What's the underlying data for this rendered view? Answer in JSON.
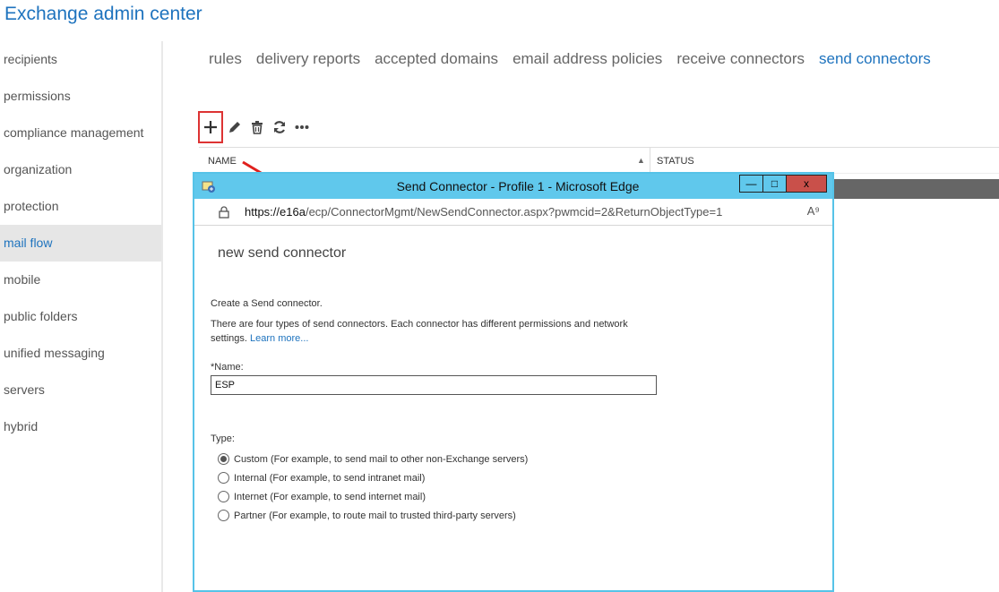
{
  "app": {
    "title": "Exchange admin center"
  },
  "sidebar": {
    "items": [
      {
        "label": "recipients"
      },
      {
        "label": "permissions"
      },
      {
        "label": "compliance management"
      },
      {
        "label": "organization"
      },
      {
        "label": "protection"
      },
      {
        "label": "mail flow",
        "active": true
      },
      {
        "label": "mobile"
      },
      {
        "label": "public folders"
      },
      {
        "label": "unified messaging"
      },
      {
        "label": "servers"
      },
      {
        "label": "hybrid"
      }
    ]
  },
  "tabs": [
    {
      "label": "rules"
    },
    {
      "label": "delivery reports"
    },
    {
      "label": "accepted domains"
    },
    {
      "label": "email address policies"
    },
    {
      "label": "receive connectors"
    },
    {
      "label": "send connectors",
      "active": true
    }
  ],
  "toolbar": {
    "buttons": [
      "add-icon",
      "edit-icon",
      "delete-icon",
      "refresh-icon",
      "more-icon"
    ],
    "highlight_color": "#dd3333"
  },
  "grid": {
    "columns": [
      "NAME",
      "STATUS"
    ],
    "sort_indicator": "▲"
  },
  "popup": {
    "window_title": "Send Connector - Profile 1 - Microsoft Edge",
    "url_host": "https://e16a",
    "url_path": "/ecp/ConnectorMgmt/NewSendConnector.aspx?pwmcid=2&ReturnObjectType=1",
    "read_aloud": "A⁹",
    "controls": {
      "minimize": "—",
      "maximize": "□",
      "close": "x"
    },
    "heading": "new send connector",
    "description1": "Create a Send connector.",
    "description2": "There are four types of send connectors. Each connector has different permissions and network settings.",
    "learn_more": "Learn more...",
    "name_label": "*Name:",
    "name_value": "ESP",
    "type_label": "Type:",
    "types": [
      {
        "label": "Custom (For example, to send mail to other non-Exchange servers)",
        "checked": true
      },
      {
        "label": "Internal (For example, to send intranet mail)",
        "checked": false
      },
      {
        "label": "Internet (For example, to send internet mail)",
        "checked": false
      },
      {
        "label": "Partner (For example, to route mail to trusted third-party servers)",
        "checked": false
      }
    ]
  },
  "colors": {
    "accent": "#1e73be",
    "titlebar": "#60c8ec",
    "close": "#c9504a"
  }
}
